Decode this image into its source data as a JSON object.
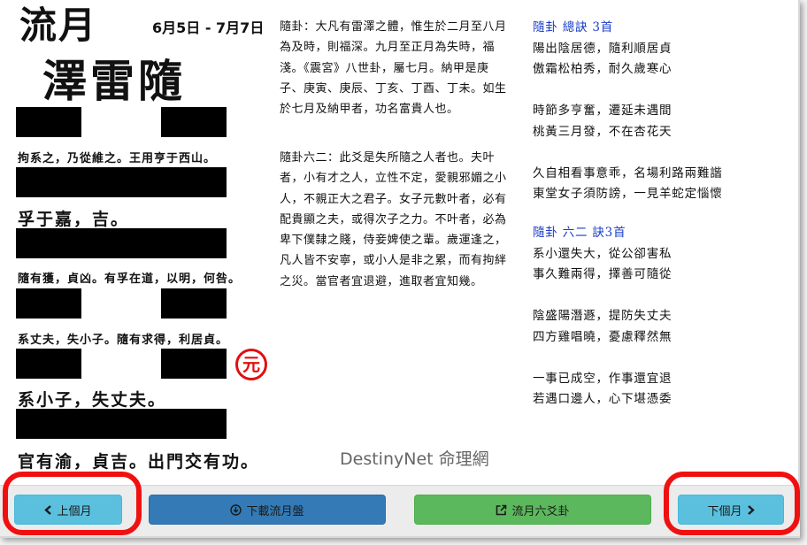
{
  "header": {
    "title": "流月",
    "date_range": "6月5日 - 7月7日",
    "gua_name": "澤雷隨"
  },
  "hexagram": {
    "yao_texts": [
      "拘系之，乃從維之。王用亨于西山。",
      "孚于嘉，吉。",
      "隨有獲，貞凶。有孚在道，以明，何咎。",
      "系丈夫，失小子。隨有求得，利居貞。",
      "系小子，失丈夫。",
      "官有渝，貞吉。出門交有功。"
    ],
    "yuan_badge": "元"
  },
  "explanation": {
    "paragraph1": "隨卦：大凡有雷澤之體，惟生於二月至八月為及時，則福深。九月至正月為失時，福淺。《震宮》八世卦，屬七月。納甲是庚子、庚寅、庚辰、丁亥、丁酉、丁未。如生於七月及納甲者，功名富貴人也。",
    "paragraph2": "隨卦六二：此爻是失所隨之人者也。夫叶者，小有才之人，立性不定，愛親邪媚之小人，不親正大之君子。女子元數叶者，必有配貴顯之夫，或得次子之力。不叶者，必為卑下僕隸之賤，侍妾婢使之輩。歲運逢之，凡人皆不安寧，或小人是非之累，而有拘絆之災。當官者宜退避，進取者宜知幾。"
  },
  "poems": {
    "overall": {
      "heading": "隨卦 總訣 3首",
      "lines": [
        "陽出陰居德，隨利順居貞",
        "傲霜松柏秀，耐久歲寒心",
        "",
        "時節多亨奮，遷延未遇間",
        "桃黃三月發，不在杏花天",
        "",
        "久自相看事意乖，名場利路兩難諧",
        "東堂女子須防謗，一見羊蛇定惱懷"
      ]
    },
    "line2": {
      "heading": "隨卦 六二 訣3首",
      "lines": [
        "系小還失大，從公卻害私",
        "事久難兩得，擇善可隨從",
        "",
        "陰盛陽潛遯，提防失丈夫",
        "四方雞唱曉，憂慮釋然無",
        "",
        "一事已成空，作事還宜退",
        "若遇口邊人，心下堪憑委"
      ]
    }
  },
  "brand": "DestinyNet 命理網",
  "footer": {
    "prev_label": "上個月",
    "download_label": "下載流月盤",
    "six_lines_label": "流月六爻卦",
    "next_label": "下個月"
  },
  "colors": {
    "info": "#5bc0de",
    "primary": "#337ab7",
    "success": "#5cb85c",
    "highlight_ring": "#f01010",
    "poem_heading": "#1a3ec8"
  }
}
